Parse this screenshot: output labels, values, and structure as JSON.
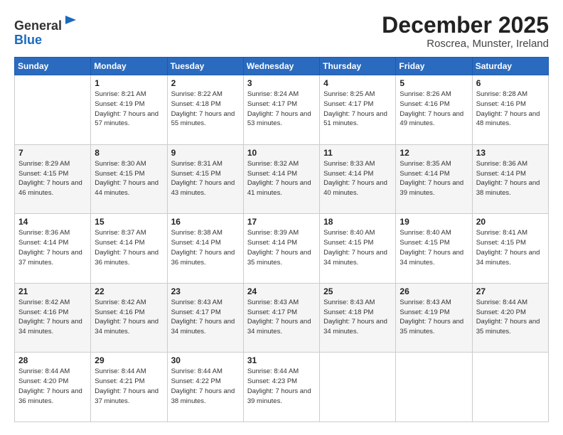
{
  "logo": {
    "general": "General",
    "blue": "Blue"
  },
  "header": {
    "month": "December 2025",
    "location": "Roscrea, Munster, Ireland"
  },
  "weekdays": [
    "Sunday",
    "Monday",
    "Tuesday",
    "Wednesday",
    "Thursday",
    "Friday",
    "Saturday"
  ],
  "weeks": [
    [
      {
        "day": "",
        "sunrise": "",
        "sunset": "",
        "daylight": ""
      },
      {
        "day": "1",
        "sunrise": "Sunrise: 8:21 AM",
        "sunset": "Sunset: 4:19 PM",
        "daylight": "Daylight: 7 hours and 57 minutes."
      },
      {
        "day": "2",
        "sunrise": "Sunrise: 8:22 AM",
        "sunset": "Sunset: 4:18 PM",
        "daylight": "Daylight: 7 hours and 55 minutes."
      },
      {
        "day": "3",
        "sunrise": "Sunrise: 8:24 AM",
        "sunset": "Sunset: 4:17 PM",
        "daylight": "Daylight: 7 hours and 53 minutes."
      },
      {
        "day": "4",
        "sunrise": "Sunrise: 8:25 AM",
        "sunset": "Sunset: 4:17 PM",
        "daylight": "Daylight: 7 hours and 51 minutes."
      },
      {
        "day": "5",
        "sunrise": "Sunrise: 8:26 AM",
        "sunset": "Sunset: 4:16 PM",
        "daylight": "Daylight: 7 hours and 49 minutes."
      },
      {
        "day": "6",
        "sunrise": "Sunrise: 8:28 AM",
        "sunset": "Sunset: 4:16 PM",
        "daylight": "Daylight: 7 hours and 48 minutes."
      }
    ],
    [
      {
        "day": "7",
        "sunrise": "Sunrise: 8:29 AM",
        "sunset": "Sunset: 4:15 PM",
        "daylight": "Daylight: 7 hours and 46 minutes."
      },
      {
        "day": "8",
        "sunrise": "Sunrise: 8:30 AM",
        "sunset": "Sunset: 4:15 PM",
        "daylight": "Daylight: 7 hours and 44 minutes."
      },
      {
        "day": "9",
        "sunrise": "Sunrise: 8:31 AM",
        "sunset": "Sunset: 4:15 PM",
        "daylight": "Daylight: 7 hours and 43 minutes."
      },
      {
        "day": "10",
        "sunrise": "Sunrise: 8:32 AM",
        "sunset": "Sunset: 4:14 PM",
        "daylight": "Daylight: 7 hours and 41 minutes."
      },
      {
        "day": "11",
        "sunrise": "Sunrise: 8:33 AM",
        "sunset": "Sunset: 4:14 PM",
        "daylight": "Daylight: 7 hours and 40 minutes."
      },
      {
        "day": "12",
        "sunrise": "Sunrise: 8:35 AM",
        "sunset": "Sunset: 4:14 PM",
        "daylight": "Daylight: 7 hours and 39 minutes."
      },
      {
        "day": "13",
        "sunrise": "Sunrise: 8:36 AM",
        "sunset": "Sunset: 4:14 PM",
        "daylight": "Daylight: 7 hours and 38 minutes."
      }
    ],
    [
      {
        "day": "14",
        "sunrise": "Sunrise: 8:36 AM",
        "sunset": "Sunset: 4:14 PM",
        "daylight": "Daylight: 7 hours and 37 minutes."
      },
      {
        "day": "15",
        "sunrise": "Sunrise: 8:37 AM",
        "sunset": "Sunset: 4:14 PM",
        "daylight": "Daylight: 7 hours and 36 minutes."
      },
      {
        "day": "16",
        "sunrise": "Sunrise: 8:38 AM",
        "sunset": "Sunset: 4:14 PM",
        "daylight": "Daylight: 7 hours and 36 minutes."
      },
      {
        "day": "17",
        "sunrise": "Sunrise: 8:39 AM",
        "sunset": "Sunset: 4:14 PM",
        "daylight": "Daylight: 7 hours and 35 minutes."
      },
      {
        "day": "18",
        "sunrise": "Sunrise: 8:40 AM",
        "sunset": "Sunset: 4:15 PM",
        "daylight": "Daylight: 7 hours and 34 minutes."
      },
      {
        "day": "19",
        "sunrise": "Sunrise: 8:40 AM",
        "sunset": "Sunset: 4:15 PM",
        "daylight": "Daylight: 7 hours and 34 minutes."
      },
      {
        "day": "20",
        "sunrise": "Sunrise: 8:41 AM",
        "sunset": "Sunset: 4:15 PM",
        "daylight": "Daylight: 7 hours and 34 minutes."
      }
    ],
    [
      {
        "day": "21",
        "sunrise": "Sunrise: 8:42 AM",
        "sunset": "Sunset: 4:16 PM",
        "daylight": "Daylight: 7 hours and 34 minutes."
      },
      {
        "day": "22",
        "sunrise": "Sunrise: 8:42 AM",
        "sunset": "Sunset: 4:16 PM",
        "daylight": "Daylight: 7 hours and 34 minutes."
      },
      {
        "day": "23",
        "sunrise": "Sunrise: 8:43 AM",
        "sunset": "Sunset: 4:17 PM",
        "daylight": "Daylight: 7 hours and 34 minutes."
      },
      {
        "day": "24",
        "sunrise": "Sunrise: 8:43 AM",
        "sunset": "Sunset: 4:17 PM",
        "daylight": "Daylight: 7 hours and 34 minutes."
      },
      {
        "day": "25",
        "sunrise": "Sunrise: 8:43 AM",
        "sunset": "Sunset: 4:18 PM",
        "daylight": "Daylight: 7 hours and 34 minutes."
      },
      {
        "day": "26",
        "sunrise": "Sunrise: 8:43 AM",
        "sunset": "Sunset: 4:19 PM",
        "daylight": "Daylight: 7 hours and 35 minutes."
      },
      {
        "day": "27",
        "sunrise": "Sunrise: 8:44 AM",
        "sunset": "Sunset: 4:20 PM",
        "daylight": "Daylight: 7 hours and 35 minutes."
      }
    ],
    [
      {
        "day": "28",
        "sunrise": "Sunrise: 8:44 AM",
        "sunset": "Sunset: 4:20 PM",
        "daylight": "Daylight: 7 hours and 36 minutes."
      },
      {
        "day": "29",
        "sunrise": "Sunrise: 8:44 AM",
        "sunset": "Sunset: 4:21 PM",
        "daylight": "Daylight: 7 hours and 37 minutes."
      },
      {
        "day": "30",
        "sunrise": "Sunrise: 8:44 AM",
        "sunset": "Sunset: 4:22 PM",
        "daylight": "Daylight: 7 hours and 38 minutes."
      },
      {
        "day": "31",
        "sunrise": "Sunrise: 8:44 AM",
        "sunset": "Sunset: 4:23 PM",
        "daylight": "Daylight: 7 hours and 39 minutes."
      },
      {
        "day": "",
        "sunrise": "",
        "sunset": "",
        "daylight": ""
      },
      {
        "day": "",
        "sunrise": "",
        "sunset": "",
        "daylight": ""
      },
      {
        "day": "",
        "sunrise": "",
        "sunset": "",
        "daylight": ""
      }
    ]
  ]
}
